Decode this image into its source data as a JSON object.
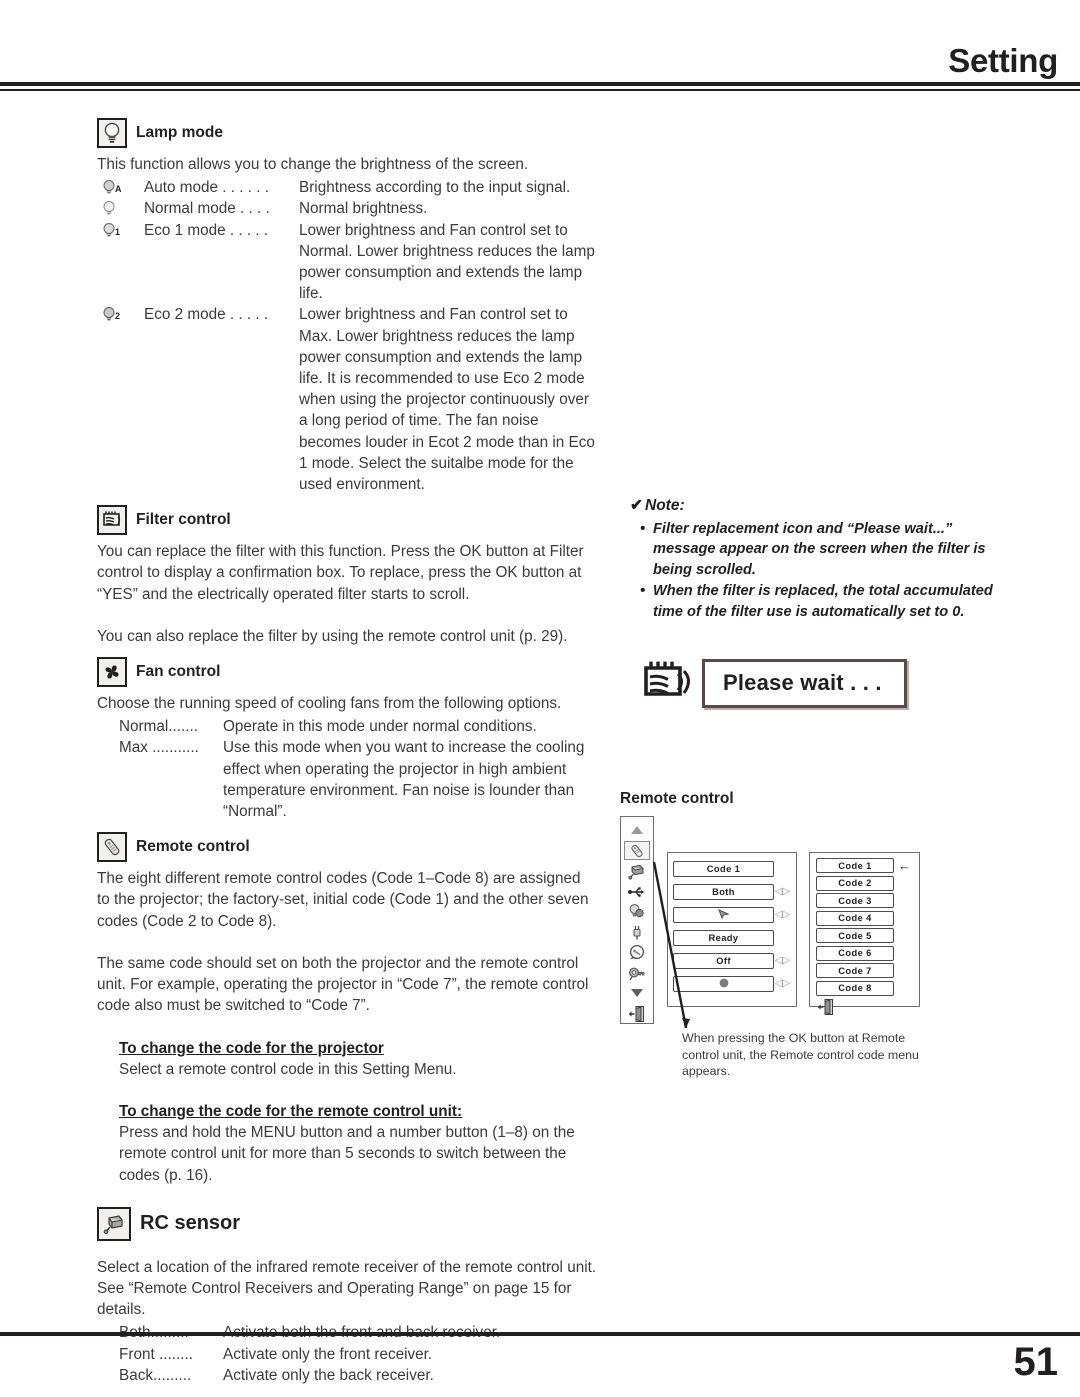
{
  "header": {
    "title": "Setting",
    "page_number": "51"
  },
  "lamp_mode": {
    "icon": "lamp-icon",
    "heading": "Lamp mode",
    "intro": "This function allows you to change the brightness of the screen.",
    "modes": [
      {
        "icon": "lamp-auto-icon",
        "term": "Auto mode . . . . . .",
        "desc": "Brightness according to the input signal."
      },
      {
        "icon": "lamp-normal-icon",
        "term": "Normal mode . . . .",
        "desc": "Normal brightness."
      },
      {
        "icon": "lamp-eco1-icon",
        "term": "Eco 1 mode . . . . .",
        "desc": "Lower brightness and Fan control set to Normal. Lower brightness reduces the lamp power consumption and extends the lamp life."
      },
      {
        "icon": "lamp-eco2-icon",
        "term": "Eco 2 mode . . . . .",
        "desc": "Lower brightness and Fan control set to Max. Lower brightness reduces the lamp power consumption and extends the lamp life. It is recommended to use Eco 2 mode when using the projector continuously over a long period of time. The fan noise becomes louder in Ecot 2 mode than in Eco 1 mode. Select the suitalbe mode for the used environment."
      }
    ]
  },
  "filter_control": {
    "icon": "filter-icon",
    "heading": "Filter control",
    "paragraph1": "You can replace the filter with this function. Press the OK button at Filter control to display a confirmation box. To replace, press the OK button at “YES” and the electrically operated filter starts to scroll.",
    "paragraph2": "You can also replace the filter by using the remote control unit (p. 29)."
  },
  "fan_control": {
    "icon": "fan-icon",
    "heading": "Fan control",
    "paragraph1": "Choose the running speed of cooling fans from the following options.",
    "options": [
      {
        "term": "Normal.......",
        "desc": "Operate in this mode under normal conditions."
      },
      {
        "term": "Max ...........",
        "desc": "Use this mode when you want to increase the cooling effect when operating the projector in high ambient temperature environment. Fan noise is lounder than “Normal”."
      }
    ]
  },
  "remote_control": {
    "icon": "remote-icon",
    "heading": "Remote control",
    "paragraph1": "The eight different remote control codes (Code 1–Code 8) are assigned to the projector; the factory-set, initial code (Code 1) and the other seven codes (Code 2 to Code 8).",
    "paragraph2": "The same code should set on both the projector and the remote control unit. For example, operating the projector in “Code 7”, the remote control code also must be switched to “Code 7”.",
    "sub1_heading": "To change the code for the projector",
    "sub1_text": "Select a remote control code in this Setting Menu.",
    "sub2_heading": "To change the code for the remote control unit:",
    "sub2_text": "Press and hold the MENU button and a number button (1–8) on the remote control unit for more than 5 seconds to switch between the codes (p. 16)."
  },
  "rc_sensor": {
    "icon": "rc-sensor-icon",
    "heading": "RC sensor",
    "paragraph1": "Select a location of the infrared remote receiver of the remote control unit. See “Remote Control Receivers and Operating Range” on page 15 for details.",
    "options": [
      {
        "term": "Both.........",
        "desc": "Activate both the front and back receiver."
      },
      {
        "term": "Front ........",
        "desc": "Activate only the front receiver."
      },
      {
        "term": "Back.........",
        "desc": "Activate only the back receiver."
      }
    ]
  },
  "note": {
    "check_mark": "✔",
    "title": "Note:",
    "bullet": "•",
    "items": [
      "Filter replacement icon and “Please wait...” message appear on the screen when the filter is being scrolled.",
      "When the filter is replaced, the total accumulated time of the filter use is automatically set to 0."
    ]
  },
  "please_wait": {
    "icon": "filter-icon",
    "message": "Please wait . . ."
  },
  "rc_diagram": {
    "title": "Remote control",
    "sidebar_icons": [
      "scroll-up-icon",
      "remote-icon",
      "rc-sensor-icon",
      "usb-icon",
      "lamp-icon",
      "power-icon",
      "closed-caption-icon",
      "security-icon",
      "scroll-down-icon",
      "quit-icon"
    ],
    "menu_rows": [
      {
        "label": "Code 1",
        "arrows": ""
      },
      {
        "label": "Both",
        "arrows": "◁▷"
      },
      {
        "label": "",
        "arrows": "◁▷",
        "glyph": "pointer-icon"
      },
      {
        "label": "Ready",
        "arrows": ""
      },
      {
        "label": "Off",
        "arrows": "◁▷"
      },
      {
        "label": "",
        "arrows": "◁▷",
        "glyph": "dot-icon"
      }
    ],
    "codes": [
      "Code 1",
      "Code 2",
      "Code 3",
      "Code 4",
      "Code 5",
      "Code 6",
      "Code 7",
      "Code 8"
    ],
    "selected_code_pointer": "←",
    "quit_icon": "quit-icon",
    "caption": "When pressing the OK button at Remote control unit, the Remote control code menu appears."
  }
}
